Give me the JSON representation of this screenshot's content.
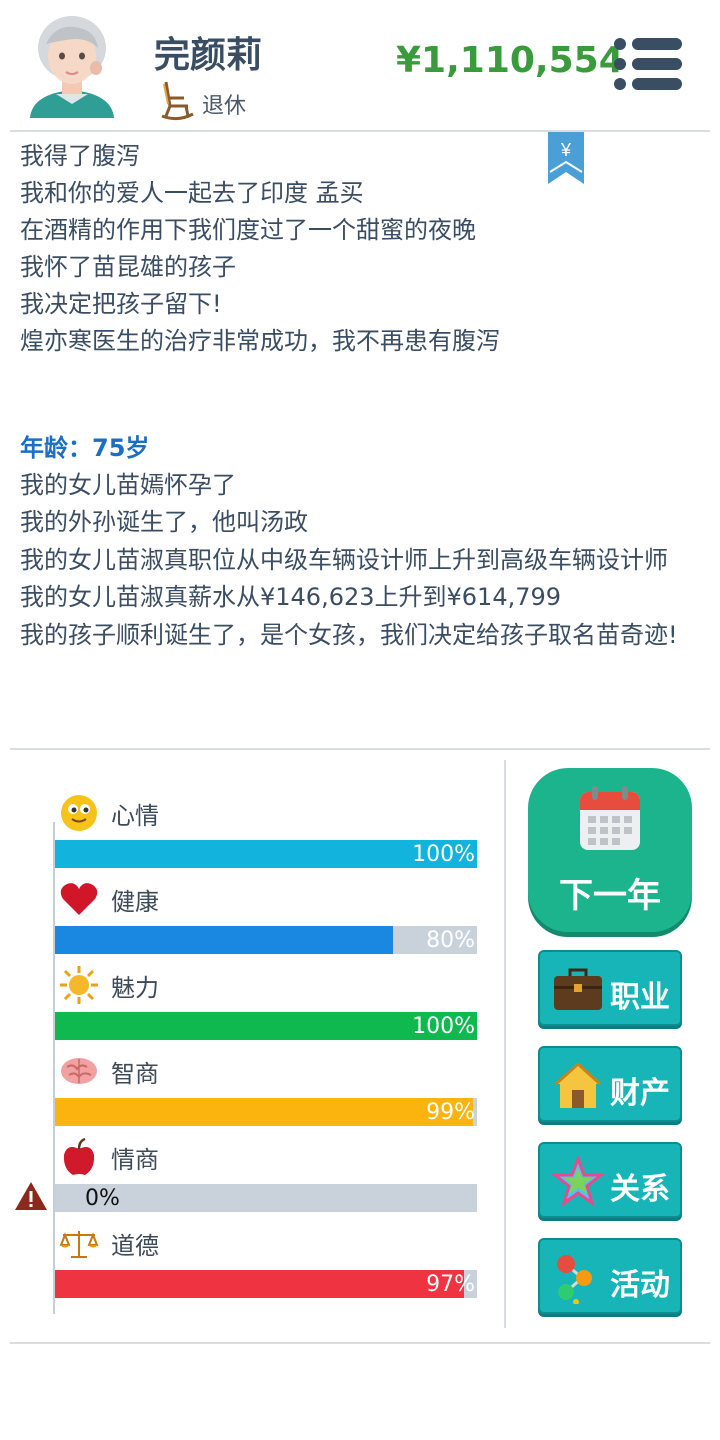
{
  "header": {
    "name": "完颜莉",
    "status": "退休",
    "money": "¥1,110,554",
    "bookmark_symbol": "¥"
  },
  "log": {
    "lines_before": [
      "我得了腹泻",
      "我和你的爱人一起去了印度 孟买",
      "在酒精的作用下我们度过了一个甜蜜的夜晚",
      "我怀了苗昆雄的孩子",
      "我决定把孩子留下!",
      "煌亦寒医生的治疗非常成功，我不再患有腹泻"
    ],
    "age_heading": "年龄：75岁",
    "lines_after": [
      "我的女儿苗嫣怀孕了",
      "我的外孙诞生了，他叫汤政",
      "我的女儿苗淑真职位从中级车辆设计师上升到高级车辆设计师",
      "我的女儿苗淑真薪水从¥146,623上升到¥614,799",
      "我的孩子顺利诞生了，是个女孩，我们决定给孩子取名苗奇迹!"
    ]
  },
  "stats": [
    {
      "label": "心情",
      "icon": "smiley-icon",
      "value": 100,
      "display": "100%",
      "color": "#12b3dc"
    },
    {
      "label": "健康",
      "icon": "heart-icon",
      "value": 80,
      "display": "80%",
      "color": "#1a88e0"
    },
    {
      "label": "魅力",
      "icon": "sun-icon",
      "value": 100,
      "display": "100%",
      "color": "#10b950"
    },
    {
      "label": "智商",
      "icon": "brain-icon",
      "value": 99,
      "display": "99%",
      "color": "#fbb30e"
    },
    {
      "label": "情商",
      "icon": "apple-icon",
      "value": 0,
      "display": "0%",
      "color": "#9aa5b1"
    },
    {
      "label": "道德",
      "icon": "scales-icon",
      "value": 97,
      "display": "97%",
      "color": "#ef3340"
    }
  ],
  "buttons": {
    "next_year": "下一年",
    "career": "职业",
    "assets": "财产",
    "relations": "关系",
    "activities": "活动"
  }
}
